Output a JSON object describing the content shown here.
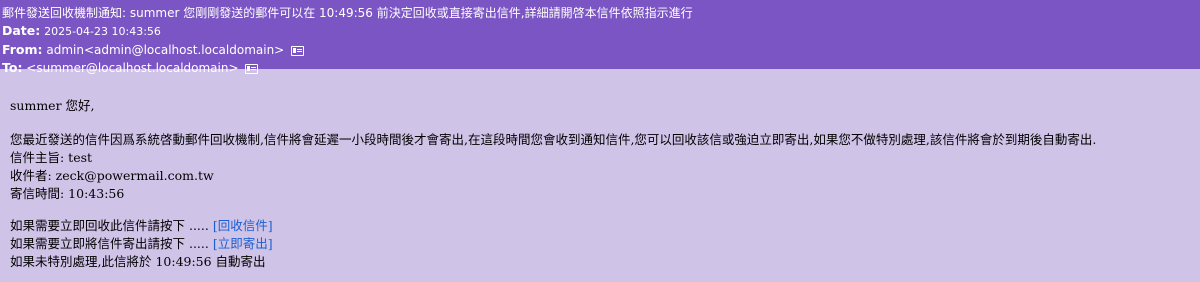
{
  "header": {
    "subject": "郵件發送回收機制通知: summer 您剛剛發送的郵件可以在 10:49:56 前決定回收或直接寄出信件,詳細請開啓本信件依照指示進行",
    "date_label": "Date:",
    "date_value": "2025-04-23 10:43:56",
    "from_label": "From:",
    "from_value": "admin<admin@localhost.localdomain>",
    "to_label": "To:",
    "to_value": "<summer@localhost.localdomain>"
  },
  "body": {
    "greeting": "summer 您好,",
    "notice": "您最近發送的信件因爲系統啓動郵件回收機制,信件將會延遲一小段時間後才會寄出,在這段時間您會收到通知信件,您可以回收該信或強迫立即寄出,如果您不做特別處理,該信件將會於到期後自動寄出.",
    "subject_line": "信件主旨: test",
    "recipient_line": "收件者: zeck@powermail.com.tw",
    "sent_time_line": "寄信時間: 10:43:56",
    "recall_prompt": "如果需要立即回收此信件請按下 ..... ",
    "recall_link": "[回收信件]",
    "send_prompt": "如果需要立即將信件寄出請按下 ..... ",
    "send_link": "[立即寄出]",
    "auto_send_line": "如果未特別處理,此信將於 10:49:56 自動寄出"
  },
  "colors": {
    "header_bg": "#7b55c3",
    "body_bg": "#cfc3e8",
    "link": "#1a5fd1"
  }
}
